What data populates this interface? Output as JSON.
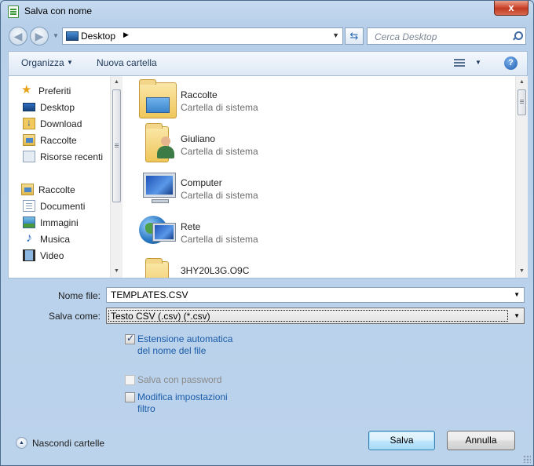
{
  "window": {
    "title": "Salva con nome",
    "close_glyph": "x"
  },
  "address_bar": {
    "location": "Desktop",
    "separator_glyph": "▶",
    "search_placeholder": "Cerca Desktop"
  },
  "toolbar": {
    "organize_label": "Organizza",
    "new_folder_label": "Nuova cartella",
    "help_glyph": "?"
  },
  "nav_pane": {
    "items": [
      {
        "label": "Preferiti",
        "icon": "star-icon"
      },
      {
        "label": "Desktop",
        "icon": "desktop-icon"
      },
      {
        "label": "Download",
        "icon": "downloads-icon"
      },
      {
        "label": "Raccolte",
        "icon": "libraries-icon"
      },
      {
        "label": "Risorse recenti",
        "icon": "recent-places-icon"
      },
      {
        "label": "Raccolte",
        "icon": "libraries-icon"
      },
      {
        "label": "Documenti",
        "icon": "documents-icon"
      },
      {
        "label": "Immagini",
        "icon": "pictures-icon"
      },
      {
        "label": "Musica",
        "icon": "music-icon"
      },
      {
        "label": "Video",
        "icon": "videos-icon"
      }
    ]
  },
  "files": [
    {
      "name": "Raccolte",
      "type": "Cartella di sistema",
      "icon": "libraries-folder-icon"
    },
    {
      "name": "Giuliano",
      "type": "Cartella di sistema",
      "icon": "user-folder-icon"
    },
    {
      "name": "Computer",
      "type": "Cartella di sistema",
      "icon": "computer-icon"
    },
    {
      "name": "Rete",
      "type": "Cartella di sistema",
      "icon": "network-icon"
    },
    {
      "name": "3HY20L3G.O9C",
      "type": "",
      "icon": "folder-icon"
    }
  ],
  "form": {
    "file_name_label": "Nome file:",
    "file_name_value": "TEMPLATES.CSV",
    "save_as_label": "Salva come:",
    "save_as_value": "Testo CSV (.csv) (*.csv)",
    "auto_extension_line1": "Estensione automatica",
    "auto_extension_line2": "del nome del file",
    "auto_extension_checked": true,
    "password_label": "Salva con password",
    "password_checked": false,
    "filter_line1": "Modifica impostazioni",
    "filter_line2": "filtro",
    "filter_checked": false
  },
  "footer": {
    "hide_folders_label": "Nascondi cartelle",
    "save_button": "Salva",
    "cancel_button": "Annulla"
  },
  "colors": {
    "window_frame": "#b9d1ea",
    "link_text": "#1a5ba8",
    "primary_button": "#bee6fd"
  }
}
